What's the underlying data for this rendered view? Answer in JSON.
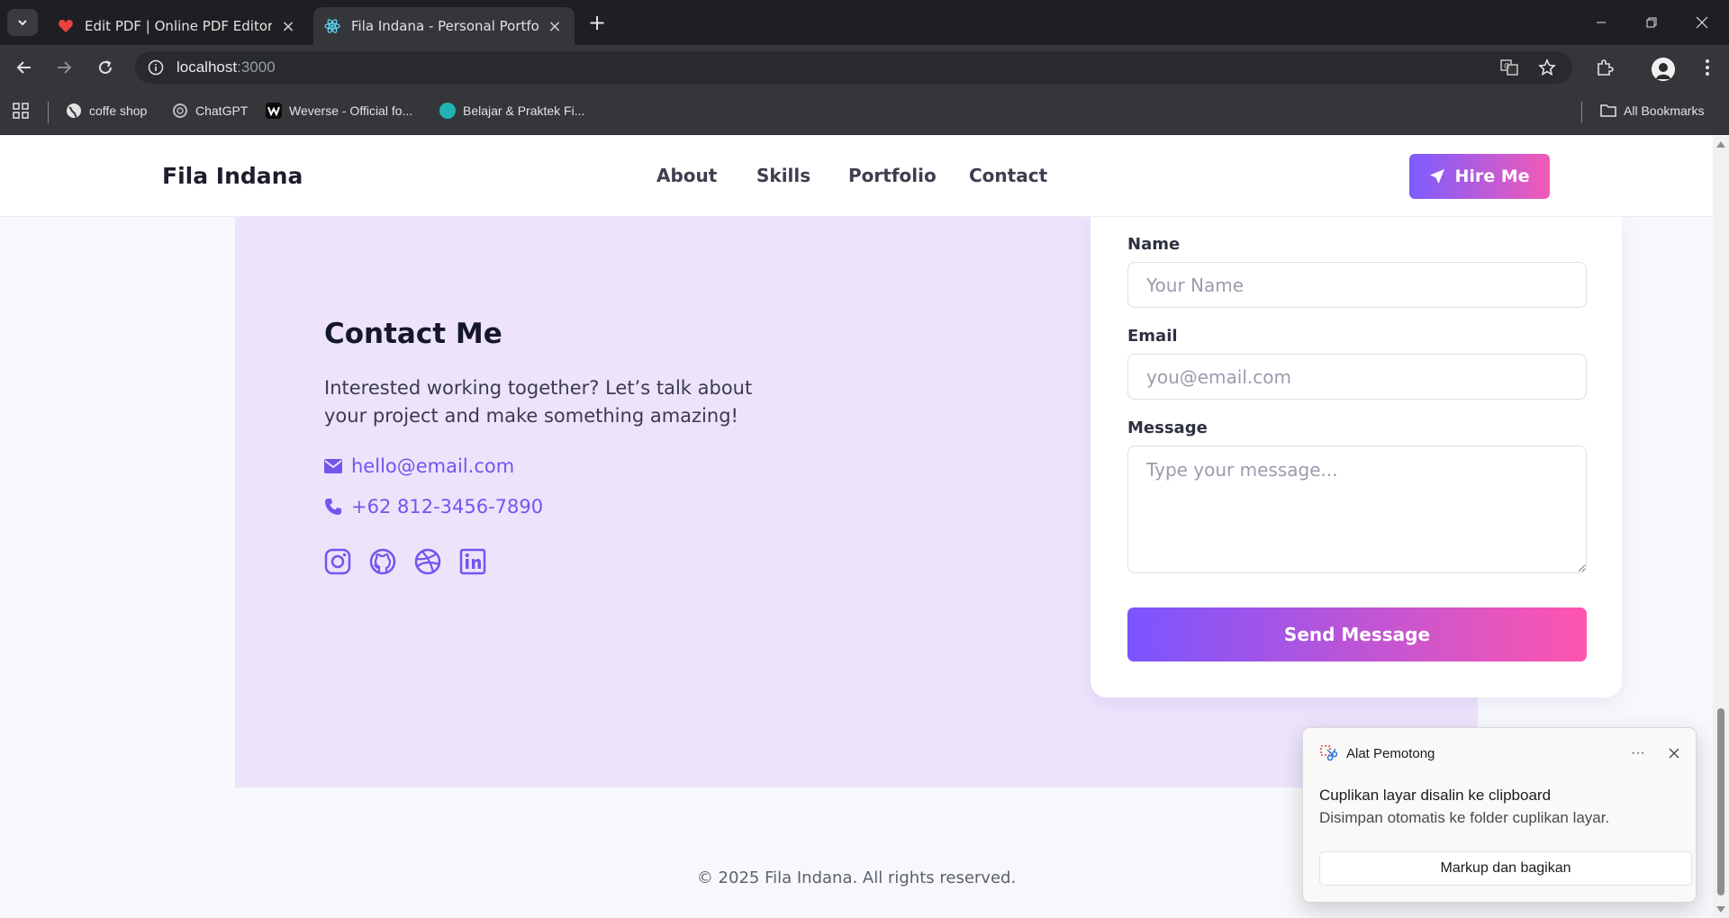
{
  "browser": {
    "tabs": [
      {
        "title": "Edit PDF | Online PDF Editor and",
        "icon": "heart-pdf-icon",
        "active": false
      },
      {
        "title": "Fila Indana - Personal Portfolio",
        "icon": "react-icon",
        "active": true
      }
    ],
    "url_host": "localhost",
    "url_port": ":3000",
    "bookmarks": [
      {
        "label": "coffe shop",
        "icon": "globe-icon"
      },
      {
        "label": "ChatGPT",
        "icon": "chatgpt-icon"
      },
      {
        "label": "Weverse - Official fo...",
        "icon": "weverse-icon"
      },
      {
        "label": "Belajar & Praktek Fi...",
        "icon": "site-icon"
      }
    ],
    "all_bookmarks": "All Bookmarks"
  },
  "header": {
    "logo": "Fila Indana",
    "nav": [
      "About",
      "Skills",
      "Portfolio",
      "Contact"
    ],
    "hire_label": "Hire Me"
  },
  "contact": {
    "title": "Contact Me",
    "description": "Interested working together? Let’s talk about your project and make something amazing!",
    "email": "hello@email.com",
    "phone": "+62 812-3456-7890",
    "socials": [
      "instagram-icon",
      "github-icon",
      "dribbble-icon",
      "linkedin-icon"
    ]
  },
  "form": {
    "name_label": "Name",
    "name_placeholder": "Your Name",
    "email_label": "Email",
    "email_placeholder": "you@email.com",
    "message_label": "Message",
    "message_placeholder": "Type your message...",
    "submit_label": "Send Message"
  },
  "footer": {
    "copyright": "© 2025 Fila Indana. All rights reserved."
  },
  "toast": {
    "app_name": "Alat Pemotong",
    "more": "···",
    "title": "Cuplikan layar disalin ke clipboard",
    "body": "Disimpan otomatis ke folder cuplikan layar.",
    "action": "Markup dan bagikan"
  },
  "colors": {
    "accent": "#7355ee",
    "gradient_start": "#7a55ff",
    "gradient_end": "#ff55ae",
    "band": "#ede3fb"
  }
}
